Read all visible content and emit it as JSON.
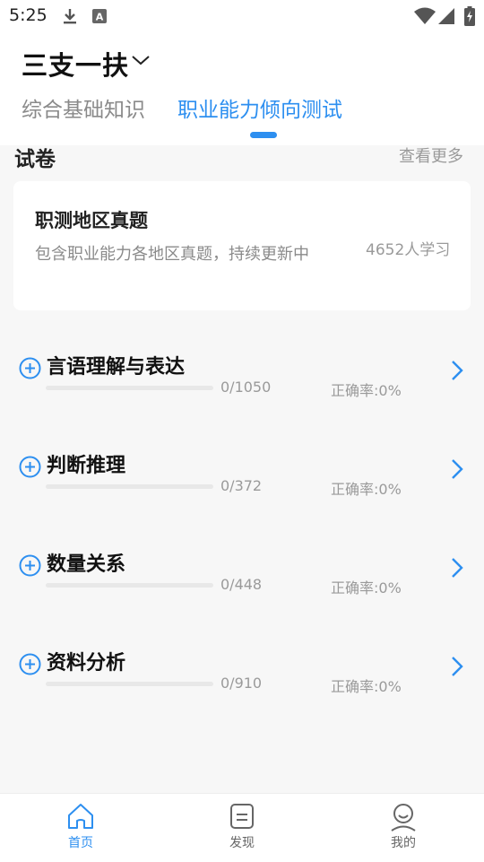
{
  "status_bar": {
    "time": "5:25",
    "icons": [
      "download-icon",
      "a-badge-icon",
      "wifi-icon",
      "signal-icon",
      "battery-charging-icon"
    ]
  },
  "header": {
    "title": "三支一扶",
    "tabs": [
      {
        "label": "综合基础知识",
        "active": false
      },
      {
        "label": "职业能力倾向测试",
        "active": true
      }
    ]
  },
  "section": {
    "title": "试卷",
    "more_label": "查看更多"
  },
  "paper_card": {
    "title": "职测地区真题",
    "description": "包含职业能力各地区真题，持续更新中",
    "learners": "4652人学习"
  },
  "categories": [
    {
      "name": "言语理解与表达",
      "progress": "0/1050",
      "accuracy": "正确率:0%",
      "fill_ratio": 0
    },
    {
      "name": "判断推理",
      "progress": "0/372",
      "accuracy": "正确率:0%",
      "fill_ratio": 0
    },
    {
      "name": "数量关系",
      "progress": "0/448",
      "accuracy": "正确率:0%",
      "fill_ratio": 0
    },
    {
      "name": "资料分析",
      "progress": "0/910",
      "accuracy": "正确率:0%",
      "fill_ratio": 0
    }
  ],
  "bottom_nav": [
    {
      "label": "首页",
      "icon": "home-icon",
      "active": true
    },
    {
      "label": "发现",
      "icon": "discover-icon",
      "active": false
    },
    {
      "label": "我的",
      "icon": "profile-icon",
      "active": false
    }
  ],
  "colors": {
    "accent": "#2d8ff0",
    "inactive": "#9a9a9a"
  }
}
